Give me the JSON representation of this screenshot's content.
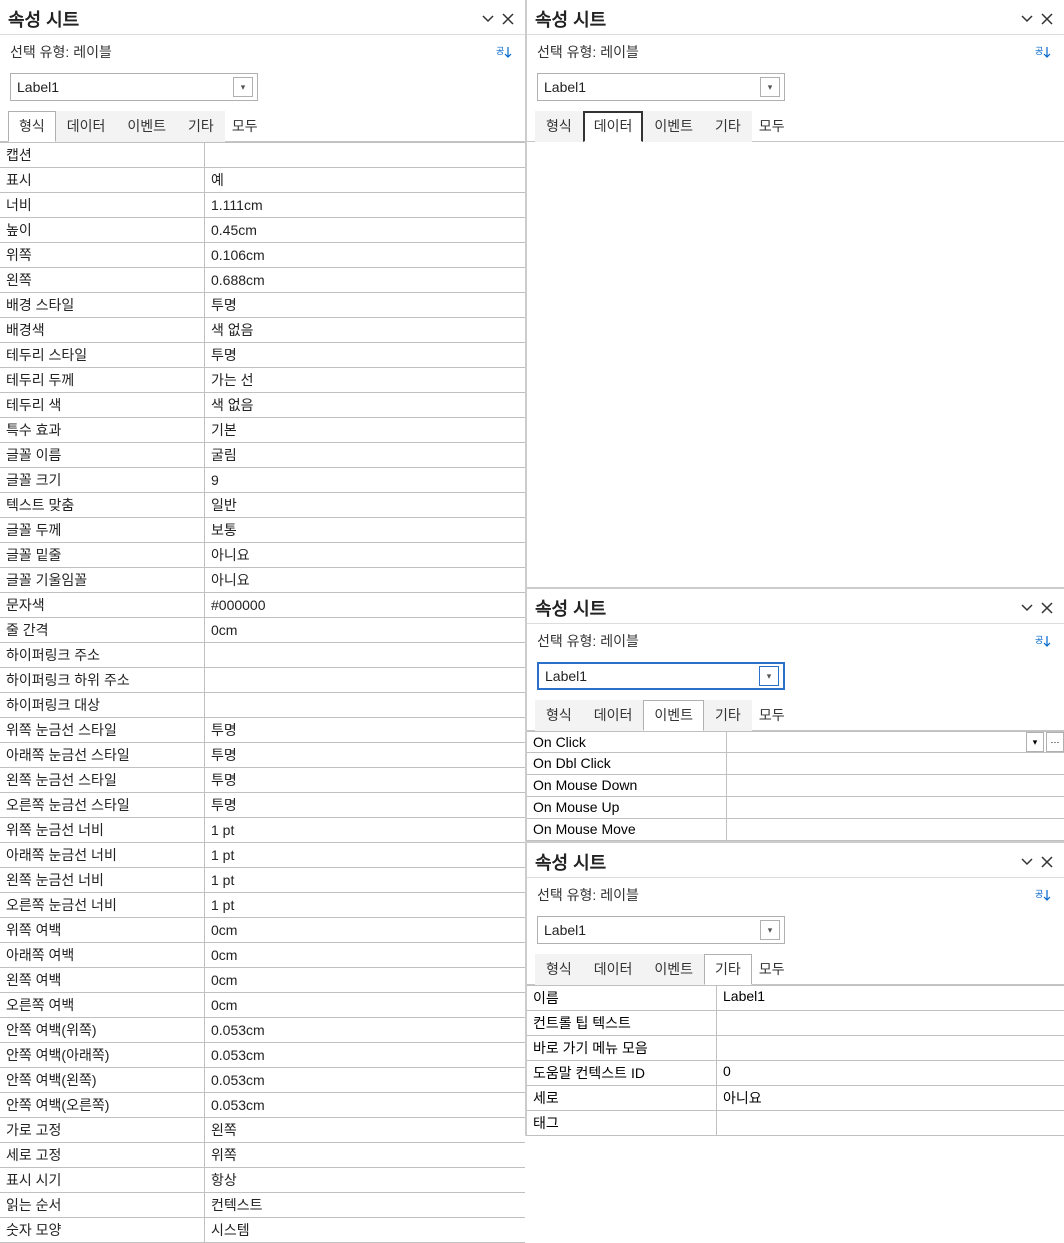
{
  "common": {
    "title": "속성 시트",
    "sel_type": "선택 유형: 레이블",
    "object": "Label1",
    "tabs": {
      "format": "형식",
      "data": "데이터",
      "event": "이벤트",
      "etc": "기타",
      "all": "모두"
    }
  },
  "p1": {
    "rows": [
      {
        "k": "캡션",
        "v": ""
      },
      {
        "k": "표시",
        "v": "예"
      },
      {
        "k": "너비",
        "v": "1.111cm"
      },
      {
        "k": "높이",
        "v": "0.45cm"
      },
      {
        "k": "위쪽",
        "v": "0.106cm"
      },
      {
        "k": "왼쪽",
        "v": "0.688cm"
      },
      {
        "k": "배경 스타일",
        "v": "투명"
      },
      {
        "k": "배경색",
        "v": "색 없음"
      },
      {
        "k": "테두리 스타일",
        "v": "투명"
      },
      {
        "k": "테두리 두께",
        "v": "가는 선"
      },
      {
        "k": "테두리 색",
        "v": "색 없음"
      },
      {
        "k": "특수 효과",
        "v": "기본"
      },
      {
        "k": "글꼴 이름",
        "v": "굴림"
      },
      {
        "k": "글꼴 크기",
        "v": "9"
      },
      {
        "k": "텍스트 맞춤",
        "v": "일반"
      },
      {
        "k": "글꼴 두께",
        "v": "보통"
      },
      {
        "k": "글꼴 밑줄",
        "v": "아니요"
      },
      {
        "k": "글꼴 기울임꼴",
        "v": "아니요"
      },
      {
        "k": "문자색",
        "v": "#000000"
      },
      {
        "k": "줄 간격",
        "v": "0cm"
      },
      {
        "k": "하이퍼링크 주소",
        "v": ""
      },
      {
        "k": "하이퍼링크 하위 주소",
        "v": ""
      },
      {
        "k": "하이퍼링크 대상",
        "v": ""
      },
      {
        "k": "위쪽 눈금선 스타일",
        "v": "투명"
      },
      {
        "k": "아래쪽 눈금선 스타일",
        "v": "투명"
      },
      {
        "k": "왼쪽 눈금선 스타일",
        "v": "투명"
      },
      {
        "k": "오른쪽 눈금선 스타일",
        "v": "투명"
      },
      {
        "k": "위쪽 눈금선 너비",
        "v": "1 pt"
      },
      {
        "k": "아래쪽 눈금선 너비",
        "v": "1 pt"
      },
      {
        "k": "왼쪽 눈금선 너비",
        "v": "1 pt"
      },
      {
        "k": "오른쪽 눈금선 너비",
        "v": "1 pt"
      },
      {
        "k": "위쪽 여백",
        "v": "0cm"
      },
      {
        "k": "아래쪽 여백",
        "v": "0cm"
      },
      {
        "k": "왼쪽 여백",
        "v": "0cm"
      },
      {
        "k": "오른쪽 여백",
        "v": "0cm"
      },
      {
        "k": "안쪽 여백(위쪽)",
        "v": "0.053cm"
      },
      {
        "k": "안쪽 여백(아래쪽)",
        "v": "0.053cm"
      },
      {
        "k": "안쪽 여백(왼쪽)",
        "v": "0.053cm"
      },
      {
        "k": "안쪽 여백(오른쪽)",
        "v": "0.053cm"
      },
      {
        "k": "가로 고정",
        "v": "왼쪽"
      },
      {
        "k": "세로 고정",
        "v": "위쪽"
      },
      {
        "k": "표시 시기",
        "v": "항상"
      },
      {
        "k": "읽는 순서",
        "v": "컨텍스트"
      },
      {
        "k": "숫자 모양",
        "v": "시스템"
      }
    ]
  },
  "p3": {
    "events": [
      "On Click",
      "On Dbl Click",
      "On Mouse Down",
      "On Mouse Up",
      "On Mouse Move"
    ]
  },
  "p4": {
    "rows": [
      {
        "k": "이름",
        "v": "Label1"
      },
      {
        "k": "컨트롤 팁 텍스트",
        "v": ""
      },
      {
        "k": "바로 가기 메뉴 모음",
        "v": ""
      },
      {
        "k": "도움말 컨텍스트 ID",
        "v": "0"
      },
      {
        "k": "세로",
        "v": "아니요"
      },
      {
        "k": "태그",
        "v": ""
      }
    ]
  }
}
